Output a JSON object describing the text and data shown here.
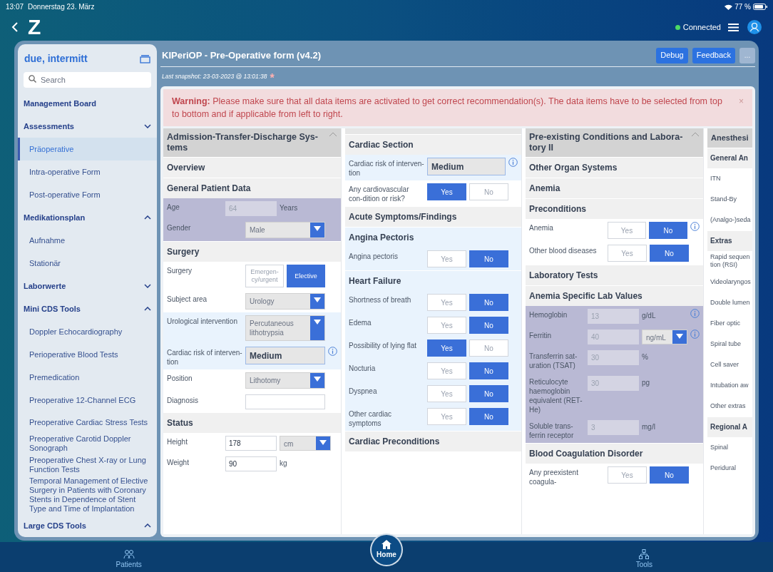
{
  "status_bar": {
    "time": "13:07",
    "date": "Donnerstag 23. März",
    "battery": "77 %"
  },
  "app_bar": {
    "logo": "Z",
    "connection": "Connected",
    "connected": true
  },
  "sidebar": {
    "patient": "due, intermitt",
    "search": {
      "placeholder": "Search"
    },
    "items": [
      {
        "label": "Management Board",
        "selected": false
      },
      {
        "label": "Assessments",
        "expanded": false,
        "selected": false,
        "children": [
          {
            "label": "Präoperative",
            "selected": true
          },
          {
            "label": "Intra-operative Form",
            "selected": false
          },
          {
            "label": "Post-operative Form",
            "selected": false
          }
        ]
      },
      {
        "label": "Medikationsplan",
        "expanded": true,
        "selected": false,
        "children": [
          {
            "label": "Aufnahme",
            "selected": false
          },
          {
            "label": "Stationär",
            "selected": false
          }
        ]
      },
      {
        "label": "Laborwerte",
        "expanded": false,
        "selected": false
      },
      {
        "label": "Mini CDS Tools",
        "expanded": true,
        "selected": false,
        "children": [
          {
            "label": "Doppler Echocardiography",
            "selected": false
          },
          {
            "label": "Perioperative Blood Tests",
            "selected": false
          },
          {
            "label": "Premedication",
            "selected": false
          },
          {
            "label": "Preoperative 12-Channel ECG",
            "selected": false
          },
          {
            "label": "Preoperative Cardiac Stress Tests",
            "selected": false
          },
          {
            "label": "Preoperative Carotid Doppler Sonograph",
            "selected": false
          },
          {
            "label": "Preoperative Chest X-ray or Lung Function Tests",
            "selected": false
          },
          {
            "label": "Temporal Management of Elective Surgery in Patients with Coronary Stents in Dependence of Stent Type and Time of Implantation",
            "selected": false
          }
        ]
      },
      {
        "label": "Large CDS Tools",
        "expanded": true,
        "selected": false
      }
    ]
  },
  "form": {
    "title": "KIPeriOP - Pre-Operative form (v4.2)",
    "buttons": [
      {
        "label": "Debug",
        "kind": "primary"
      },
      {
        "label": "Feedback",
        "kind": "primary"
      },
      {
        "label": "...",
        "kind": "more"
      }
    ],
    "snapshot": "Last snapshot: 23-03-2023 @ 13:01:38",
    "snapshot_marker": "*",
    "warning": {
      "text": "**Warning:** Please make sure that all data items are activated to get correct recommendation(s). The data items have to be selected from top to bottom and if applicable from left to right.",
      "close": "×"
    },
    "columns": [
      {
        "title": "Admission-Transfer-Discharge Sys-tems",
        "expanded": true,
        "items": [
          {
            "kind": "header",
            "label": "Overview",
            "color": "#f0f0f0"
          },
          {
            "kind": "header",
            "label": "General Patient Data",
            "color": "#f0f0f0"
          },
          {
            "kind": "field",
            "label": "Age",
            "value": "64",
            "unit": "Years",
            "disabled": true,
            "color": "#b9b9d4"
          },
          {
            "kind": "select",
            "label": "Gender",
            "value": "Male",
            "color": "#b9b9d4"
          },
          {
            "kind": "header",
            "label": "Surgery",
            "color": "#f0f0f0"
          },
          {
            "kind": "choice",
            "label": "Surgery",
            "options": [
              {
                "label": "Emergen-cy/urgent",
                "selected": false
              },
              {
                "label": "Elective",
                "selected": true
              }
            ]
          },
          {
            "kind": "select",
            "label": "Subject area",
            "value": "Urology"
          },
          {
            "kind": "select",
            "label": "Urological intervention",
            "value": "Percutaneous lithotrypsia",
            "color": "#e9f3fd"
          },
          {
            "kind": "result",
            "label": "Cardiac risk of interven-tion",
            "value": "Medium",
            "info": true,
            "color": "#e9f3fd"
          },
          {
            "kind": "select",
            "label": "Position",
            "value": "Lithotomy"
          },
          {
            "kind": "field",
            "label": "Diagnosis",
            "disabled": false
          },
          {
            "kind": "header",
            "label": "Status",
            "color": "#f0f0f0"
          },
          {
            "kind": "field",
            "label": "Height",
            "value": "178",
            "unit_select": "cm",
            "disabled": false
          },
          {
            "kind": "field",
            "label": "Weight",
            "value": "90",
            "unit": "kg",
            "disabled": false
          }
        ]
      },
      {
        "items": [
          {
            "kind": "header",
            "label": "Cardiac Section",
            "color": "#f0f0f0"
          },
          {
            "kind": "result",
            "label": "Cardiac risk of interven-tion",
            "value": "Medium",
            "info": true,
            "color": "#e9f3fd"
          },
          {
            "kind": "choice",
            "label": "Any cardiovascular con-dition or risk?",
            "options": [
              {
                "label": "Yes",
                "selected": true
              },
              {
                "label": "No",
                "selected": false
              }
            ]
          },
          {
            "kind": "header",
            "label": "Acute Symptoms/Findings",
            "color": "#f0f0f0"
          },
          {
            "kind": "header",
            "label": "Angina Pectoris",
            "color": "#e9f3fd"
          },
          {
            "kind": "choice",
            "label": "Angina pectoris",
            "color": "#e9f3fd",
            "options": [
              {
                "label": "Yes",
                "selected": false
              },
              {
                "label": "No",
                "selected": true
              }
            ]
          },
          {
            "kind": "header",
            "label": "Heart Failure",
            "color": "#e9f3fd"
          },
          {
            "kind": "choice",
            "label": "Shortness of breath",
            "color": "#e9f3fd",
            "options": [
              {
                "label": "Yes",
                "selected": false
              },
              {
                "label": "No",
                "selected": true
              }
            ]
          },
          {
            "kind": "choice",
            "label": "Edema",
            "color": "#e9f3fd",
            "options": [
              {
                "label": "Yes",
                "selected": false
              },
              {
                "label": "No",
                "selected": true
              }
            ]
          },
          {
            "kind": "choice",
            "label": "Possibility of lying flat",
            "color": "#e9f3fd",
            "options": [
              {
                "label": "Yes",
                "selected": true
              },
              {
                "label": "No",
                "selected": false
              }
            ]
          },
          {
            "kind": "choice",
            "label": "Nocturia",
            "color": "#e9f3fd",
            "options": [
              {
                "label": "Yes",
                "selected": false
              },
              {
                "label": "No",
                "selected": true
              }
            ]
          },
          {
            "kind": "choice",
            "label": "Dyspnea",
            "color": "#e9f3fd",
            "options": [
              {
                "label": "Yes",
                "selected": false
              },
              {
                "label": "No",
                "selected": true
              }
            ]
          },
          {
            "kind": "choice",
            "label": "Other cardiac symptoms",
            "color": "#e9f3fd",
            "options": [
              {
                "label": "Yes",
                "selected": false
              },
              {
                "label": "No",
                "selected": true
              }
            ]
          },
          {
            "kind": "header",
            "label": "Cardiac Preconditions",
            "color": "#f0f0f0"
          }
        ]
      },
      {
        "title": "Pre-existing Conditions and Labora-tory II",
        "expanded": true,
        "items": [
          {
            "kind": "header",
            "label": "Other Organ Systems",
            "color": "#f0f0f0"
          },
          {
            "kind": "header",
            "label": "Anemia",
            "color": "#f0f0f0"
          },
          {
            "kind": "header",
            "label": "Preconditions",
            "color": "#f0f0f0"
          },
          {
            "kind": "choice",
            "label": "Anemia",
            "info": true,
            "options": [
              {
                "label": "Yes",
                "selected": false
              },
              {
                "label": "No",
                "selected": true
              }
            ]
          },
          {
            "kind": "choice",
            "label": "Other blood diseases",
            "options": [
              {
                "label": "Yes",
                "selected": false
              },
              {
                "label": "No",
                "selected": true
              }
            ]
          },
          {
            "kind": "header",
            "label": "Laboratory Tests",
            "color": "#f0f0f0"
          },
          {
            "kind": "header",
            "label": "Anemia Specific Lab Values",
            "color": "#f0f0f0"
          },
          {
            "kind": "field",
            "label": "Hemoglobin",
            "value": "13",
            "unit": "g/dL",
            "info": true,
            "disabled": true,
            "color": "#b9b9d4"
          },
          {
            "kind": "field",
            "label": "Ferritin",
            "value": "40",
            "unit_select": "ng/mL",
            "info": true,
            "disabled": true,
            "color": "#b9b9d4"
          },
          {
            "kind": "field",
            "label": "Transferrin sat-uration (TSAT)",
            "value": "30",
            "unit": "%",
            "disabled": true,
            "color": "#b9b9d4"
          },
          {
            "kind": "field",
            "label": "Reticulocyte haemoglobin equivalent (RET-He)",
            "value": "30",
            "unit": "pg",
            "disabled": true,
            "color": "#b9b9d4"
          },
          {
            "kind": "field",
            "label": "Soluble trans-ferrin receptor",
            "value": "3",
            "unit": "mg/l",
            "disabled": true,
            "color": "#b9b9d4"
          },
          {
            "kind": "header",
            "label": "Blood Coagulation Disorder",
            "color": "#f0f0f0"
          },
          {
            "kind": "choice",
            "label": "Any preexistent coagula-",
            "options": [
              {
                "label": "Yes",
                "selected": false
              },
              {
                "label": "No",
                "selected": true
              }
            ]
          }
        ]
      },
      {
        "title": "Anesthesi",
        "items": [
          {
            "kind": "header",
            "label": "General An",
            "color": "#f0f0f0"
          },
          {
            "kind": "option",
            "label": "ITN"
          },
          {
            "kind": "option",
            "label": "Stand-By"
          },
          {
            "kind": "option",
            "label": "(Analgo-)seda"
          },
          {
            "kind": "header",
            "label": "Extras",
            "color": "#f0f0f0"
          },
          {
            "kind": "option",
            "label": "Rapid sequen tion (RSI)"
          },
          {
            "kind": "option",
            "label": "Videolaryngos"
          },
          {
            "kind": "option",
            "label": "Double lumen"
          },
          {
            "kind": "option",
            "label": "Fiber optic"
          },
          {
            "kind": "option",
            "label": "Spiral tube"
          },
          {
            "kind": "option",
            "label": "Cell saver"
          },
          {
            "kind": "option",
            "label": "Intubation aw"
          },
          {
            "kind": "option",
            "label": "Other extras"
          },
          {
            "kind": "header",
            "label": "Regional A",
            "color": "#f0f0f0"
          },
          {
            "kind": "option",
            "label": "Spinal"
          },
          {
            "kind": "option",
            "label": "Peridural"
          }
        ]
      }
    ]
  },
  "bottom_nav": [
    {
      "label": "Patients",
      "kind": "side",
      "selected": false
    },
    {
      "label": "Home",
      "kind": "center",
      "selected": true
    },
    {
      "label": "Tools",
      "kind": "side",
      "selected": false
    }
  ]
}
